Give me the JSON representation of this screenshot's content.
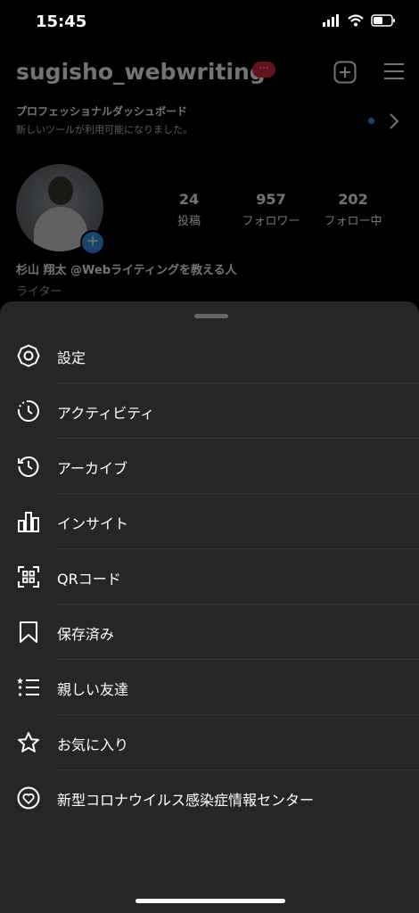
{
  "status_bar": {
    "time": "15:45"
  },
  "profile": {
    "username": "sugisho_webwriting",
    "badge": "···",
    "dashboard_title": "プロフェッショナルダッシュボード",
    "dashboard_subtitle": "新しいツールが利用可能になりました。",
    "stats": [
      {
        "number": "24",
        "label": "投稿"
      },
      {
        "number": "957",
        "label": "フォロワー"
      },
      {
        "number": "202",
        "label": "フォロー中"
      }
    ],
    "bio_name": "杉山 翔太 @Webライティングを教える人",
    "bio_category": "ライター"
  },
  "menu": {
    "items": [
      {
        "label": "設定",
        "icon": "settings-icon"
      },
      {
        "label": "アクティビティ",
        "icon": "activity-icon"
      },
      {
        "label": "アーカイブ",
        "icon": "archive-icon"
      },
      {
        "label": "インサイト",
        "icon": "insights-icon"
      },
      {
        "label": "QRコード",
        "icon": "qr-code-icon"
      },
      {
        "label": "保存済み",
        "icon": "bookmark-icon"
      },
      {
        "label": "親しい友達",
        "icon": "close-friends-icon"
      },
      {
        "label": "お気に入り",
        "icon": "star-icon"
      },
      {
        "label": "新型コロナウイルス感染症情報センター",
        "icon": "covid-info-icon"
      }
    ]
  },
  "colors": {
    "sheet": "#262626",
    "accent": "#3897f0",
    "badge": "#e0283a"
  }
}
